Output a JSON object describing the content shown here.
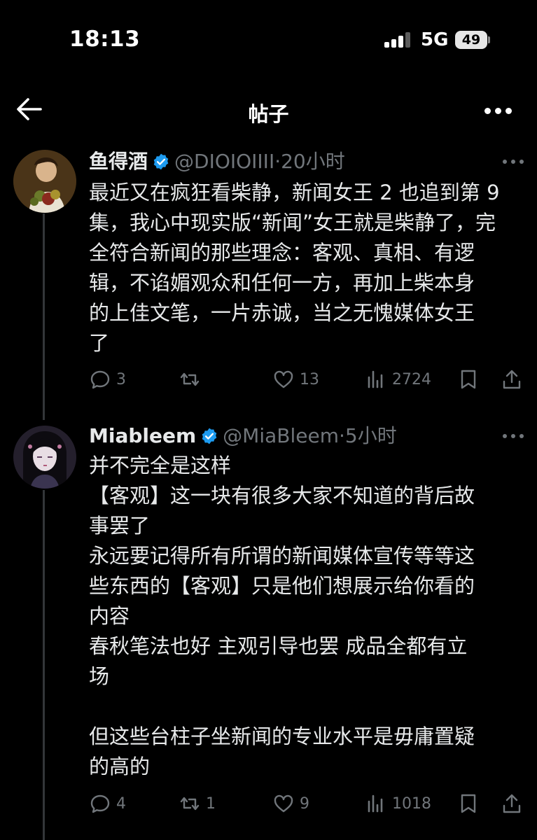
{
  "status_bar": {
    "time": "18:13",
    "network": "5G",
    "battery": "49"
  },
  "nav": {
    "title": "帖子",
    "back_icon": "arrow-left-icon",
    "more_icon": "ellipsis-icon"
  },
  "colors": {
    "background": "#000000",
    "text": "#e7e9ea",
    "muted": "#71767b",
    "verified": "#1d9bf0",
    "divider": "#333639"
  },
  "tweets": [
    {
      "name": "鱼得酒",
      "handle": "@DIOIOIIII",
      "dot": "·",
      "ago": "20小时",
      "lines": [
        "最近又在疯狂看柴静，新闻女王 2 也追到第 9",
        "集，我心中现实版“新闻”女王就是柴静了，完",
        "全符合新闻的那些理念：客观、真相、有逻",
        "辑，不谄媚观众和任何一方，再加上柴本身",
        "的上佳文笔，一片赤诚，当之无愧媒体女王",
        "了"
      ],
      "replies": "3",
      "retweets": "",
      "likes": "13",
      "views": "2724"
    },
    {
      "name": "Miableem",
      "handle": "@MiaBleem",
      "dot": "·",
      "ago": "5小时",
      "lines": [
        "并不完全是这样",
        "【客观】这一块有很多大家不知道的背后故",
        "事罢了",
        "永远要记得所有所谓的新闻媒体宣传等等这",
        "些东西的【客观】只是他们想展示给你看的",
        "内容",
        "春秋笔法也好 主观引导也罢 成品全都有立",
        "场",
        "",
        "但这些台柱子坐新闻的专业水平是毋庸置疑",
        "的高的"
      ],
      "replies": "4",
      "retweets": "1",
      "likes": "9",
      "views": "1018"
    }
  ]
}
